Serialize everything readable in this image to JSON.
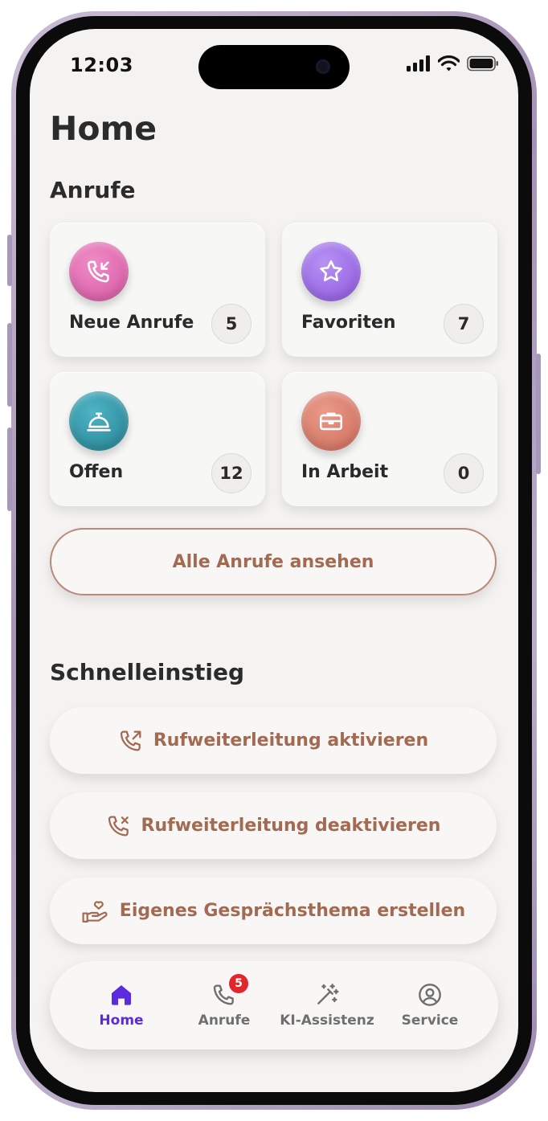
{
  "status_bar": {
    "time": "12:03"
  },
  "page": {
    "title": "Home"
  },
  "calls_section": {
    "title": "Anrufe",
    "tiles": [
      {
        "label": "Neue Anrufe",
        "count": "5",
        "icon": "phone-incoming-icon",
        "color": "#d965a8"
      },
      {
        "label": "Favoriten",
        "count": "7",
        "icon": "star-icon",
        "color": "#9a68e4"
      },
      {
        "label": "Offen",
        "count": "12",
        "icon": "service-bell-icon",
        "color": "#2f93a6"
      },
      {
        "label": "In Arbeit",
        "count": "0",
        "icon": "briefcase-icon",
        "color": "#d77d6b"
      }
    ],
    "view_all_label": "Alle Anrufe ansehen"
  },
  "quick_section": {
    "title": "Schnelleinstieg",
    "actions": [
      {
        "label": "Rufweiterleitung aktivieren",
        "icon": "phone-forward-icon"
      },
      {
        "label": "Rufweiterleitung deaktivieren",
        "icon": "phone-x-icon"
      },
      {
        "label": "Eigenes Gesprächsthema erstellen",
        "icon": "hand-heart-icon"
      }
    ]
  },
  "tab_bar": {
    "tabs": [
      {
        "label": "Home",
        "icon": "home-icon",
        "active": true
      },
      {
        "label": "Anrufe",
        "icon": "phone-icon",
        "badge": "5"
      },
      {
        "label": "KI-Assistenz",
        "icon": "magic-wand-icon"
      },
      {
        "label": "Service",
        "icon": "user-circle-icon"
      }
    ]
  },
  "colors": {
    "accent": "#a36a52",
    "active_tab": "#5b2be0",
    "badge": "#e3262c"
  }
}
